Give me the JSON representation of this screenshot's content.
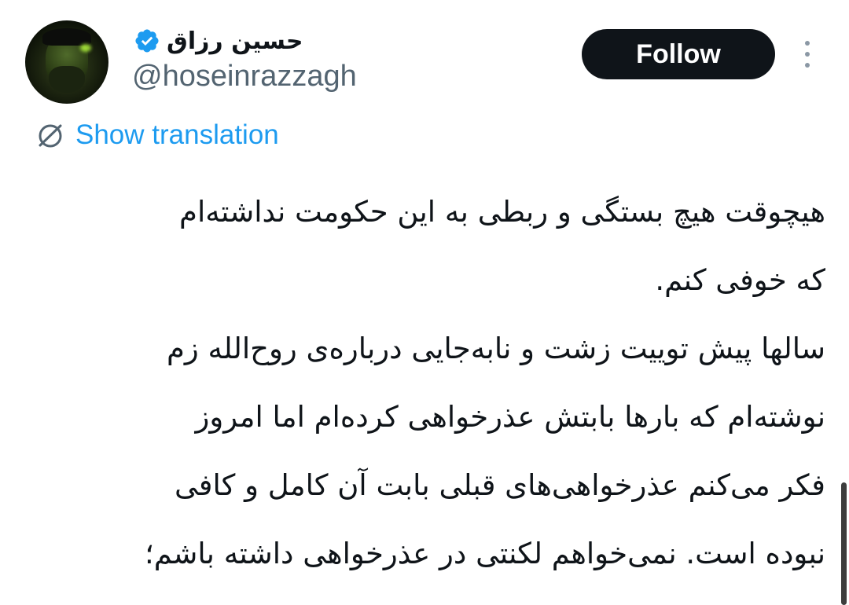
{
  "author": {
    "display_name": "حسین رزاق",
    "handle": "@hoseinrazzagh",
    "verified": true
  },
  "actions": {
    "follow_label": "Follow",
    "more_icon": "more-vertical-icon"
  },
  "translation": {
    "label": "Show translation",
    "icon": "translate-globe-icon"
  },
  "tweet": {
    "lines": [
      "هیچوقت هیچ بستگی و ربطی به این حکومت نداشته‌ام",
      "که خوفی کنم.",
      "سالها پیش توییت زشت و نابه‌جایی درباره‌ی روح‌الله زم",
      "نوشته‌ام که بارها بابتش عذرخواهی کرده‌ام اما امروز",
      "فکر می‌کنم عذرخواهی‌های قبلی بابت آن کامل و کافی",
      "نبوده است.  نمی‌خواهم لکنتی در عذرخواهی داشته باشم؛"
    ]
  },
  "colors": {
    "text_primary": "#0f1419",
    "text_secondary": "#536471",
    "link_blue": "#1d9bf0",
    "button_bg": "#0f1419",
    "verified_blue": "#1d9bf0"
  }
}
